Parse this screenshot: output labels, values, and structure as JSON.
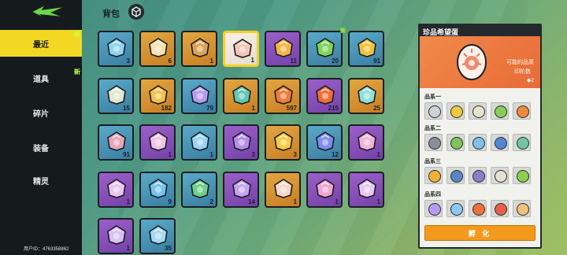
{
  "sidebar": {
    "items": [
      {
        "label": "最近",
        "active": true
      },
      {
        "label": "道具",
        "active": false
      },
      {
        "label": "碎片",
        "active": false
      },
      {
        "label": "装备",
        "active": false
      },
      {
        "label": "精灵",
        "active": false
      }
    ],
    "new_tags": [
      "新",
      "新"
    ],
    "uid": "用户ID：4763358862"
  },
  "header": {
    "title": "背包"
  },
  "grid": {
    "new_tag": "新",
    "items": [
      {
        "qty": "3",
        "rarity": "blue",
        "icon": "map-scroll-icon",
        "color": "#8fd3f0"
      },
      {
        "qty": "6",
        "rarity": "gold",
        "icon": "hourglass-icon",
        "color": "#f4e3b0"
      },
      {
        "qty": "1",
        "rarity": "gold",
        "icon": "photo-frame-icon",
        "color": "#d9a45a"
      },
      {
        "qty": "1",
        "rarity": "selected",
        "icon": "candy-egg-icon",
        "color": "#f5c6b8"
      },
      {
        "qty": "11",
        "rarity": "purple",
        "icon": "crystal-shard-icon",
        "color": "#f1b645"
      },
      {
        "qty": "20",
        "rarity": "blue",
        "icon": "green-fruit-icon",
        "color": "#7fd65a"
      },
      {
        "qty": "91",
        "rarity": "blue",
        "icon": "gold-key-icon",
        "color": "#f0c23d"
      },
      {
        "qty": "15",
        "rarity": "blue",
        "icon": "feather-leaf-icon",
        "color": "#dfe8d0"
      },
      {
        "qty": "182",
        "rarity": "gold",
        "icon": "magic-orb-icon",
        "color": "#f3c24a"
      },
      {
        "qty": "79",
        "rarity": "blue",
        "icon": "potion-bottle-icon",
        "color": "#b69cf2"
      },
      {
        "qty": "1",
        "rarity": "gold",
        "icon": "spirit-flower-icon",
        "color": "#63c7b5"
      },
      {
        "qty": "597",
        "rarity": "gold",
        "icon": "juice-cup-icon",
        "color": "#f07c39"
      },
      {
        "qty": "215",
        "rarity": "purple",
        "icon": "sauce-bottle-icon",
        "color": "#ef6f3a"
      },
      {
        "qty": "25",
        "rarity": "gold",
        "icon": "soda-jar-icon",
        "color": "#8fe0d6"
      },
      {
        "qty": "91",
        "rarity": "blue",
        "icon": "torn-scroll-icon",
        "color": "#e7a6b6"
      },
      {
        "qty": "1",
        "rarity": "purple",
        "icon": "puzzle-shard-icon",
        "color": "#f1c4e6"
      },
      {
        "qty": "1",
        "rarity": "blue",
        "icon": "blue-potion-icon",
        "color": "#9ad3f6"
      },
      {
        "qty": "3",
        "rarity": "purple",
        "icon": "stone-tablet-icon",
        "color": "#b290e6"
      },
      {
        "qty": "3",
        "rarity": "gold",
        "icon": "gold-crystal-icon",
        "color": "#f7cc44"
      },
      {
        "qty": "12",
        "rarity": "blue",
        "icon": "berry-cluster-icon",
        "color": "#7f8ff0"
      },
      {
        "qty": "1",
        "rarity": "purple",
        "icon": "fox-card-icon",
        "color": "#f2b3d6"
      },
      {
        "qty": "1",
        "rarity": "purple",
        "icon": "monster-puzzle-icon",
        "color": "#e9c6ee"
      },
      {
        "qty": "9",
        "rarity": "blue",
        "icon": "water-potion-icon",
        "color": "#74c4ee"
      },
      {
        "qty": "2",
        "rarity": "blue",
        "icon": "green-potion-icon",
        "color": "#6fd08a"
      },
      {
        "qty": "14",
        "rarity": "purple",
        "icon": "purple-potion-icon",
        "color": "#c4a5ef"
      },
      {
        "qty": "1",
        "rarity": "gold",
        "icon": "cat-badge-icon",
        "color": "#f8d6c6"
      },
      {
        "qty": "1",
        "rarity": "purple",
        "icon": "dancer-puzzle-icon",
        "color": "#f0a6d0"
      },
      {
        "qty": "1",
        "rarity": "purple",
        "icon": "snail-puzzle-icon",
        "color": "#e6c9f2"
      },
      {
        "qty": "1",
        "rarity": "purple",
        "icon": "spell-book-icon",
        "color": "#d8c1f3"
      },
      {
        "qty": "35",
        "rarity": "blue",
        "icon": "blue-scroll-icon",
        "color": "#a6d9f4"
      }
    ]
  },
  "panel": {
    "title": "珍品希望蛋",
    "possible_label": "可能的品质",
    "seal_label": "印阶数",
    "seal_count": "2",
    "groups": [
      {
        "label": "品系一",
        "icons": [
          {
            "name": "dog-spirit-icon",
            "color": "#cfd3d8"
          },
          {
            "name": "chick-spirit-icon",
            "color": "#f3c93a"
          },
          {
            "name": "sheep-spirit-icon",
            "color": "#e7e2c9"
          },
          {
            "name": "frog-spirit-icon",
            "color": "#86cf5b"
          },
          {
            "name": "fox-spirit-icon",
            "color": "#f08a3a"
          }
        ]
      },
      {
        "label": "品系二",
        "icons": [
          {
            "name": "robot-spirit-icon",
            "color": "#8b8f98"
          },
          {
            "name": "sprout-spirit-icon",
            "color": "#7fc45a"
          },
          {
            "name": "snail-spirit-icon",
            "color": "#7fc0e8"
          },
          {
            "name": "water-spirit-icon",
            "color": "#4f86d6"
          },
          {
            "name": "flower-spirit-icon",
            "color": "#6fc7a0"
          }
        ]
      },
      {
        "label": "品系三",
        "icons": [
          {
            "name": "bee-spirit-icon",
            "color": "#f2b134"
          },
          {
            "name": "penguin-spirit-icon",
            "color": "#5a86c6"
          },
          {
            "name": "owl-spirit-icon",
            "color": "#8d7fc7"
          },
          {
            "name": "cloud-spirit-icon",
            "color": "#e6e0d2"
          },
          {
            "name": "cactus-spirit-icon",
            "color": "#8ccf4a"
          }
        ]
      },
      {
        "label": "品系四",
        "icons": [
          {
            "name": "bunny-spirit-icon",
            "color": "#b79af2"
          },
          {
            "name": "ice-spirit-icon",
            "color": "#8cc8ef"
          },
          {
            "name": "fire-spirit-icon",
            "color": "#f0703a"
          },
          {
            "name": "mushroom-spirit-icon",
            "color": "#e95f4b"
          },
          {
            "name": "kitten-spirit-icon",
            "color": "#f2c17a"
          }
        ]
      }
    ],
    "hatch_label": "孵 化"
  }
}
